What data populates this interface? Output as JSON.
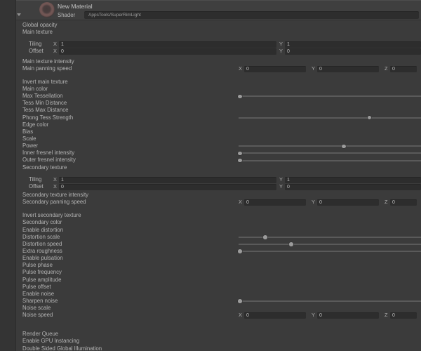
{
  "header": {
    "title": "New Material",
    "shader_label": "Shader",
    "shader_value": "AppsTools/SuperRimLight"
  },
  "colors": {
    "background": "#3b3b3b",
    "left_strip": "#343434",
    "field_background": "#2d2d2d",
    "text": "#b4b4b4",
    "slider_handle": "#9b9b9b",
    "material_icon_ring": "#735755"
  },
  "rows": [
    {
      "label": "Global opacity",
      "type": "label"
    },
    {
      "label": "Main texture",
      "type": "label"
    },
    {
      "label": "Tiling",
      "type": "vec2",
      "indent": true,
      "gap": 7,
      "fields": [
        {
          "axis": "X",
          "value": "1"
        },
        {
          "axis": "Y",
          "value": "1"
        }
      ]
    },
    {
      "label": "Offset",
      "type": "vec2",
      "indent": true,
      "fields": [
        {
          "axis": "X",
          "value": "0"
        },
        {
          "axis": "Y",
          "value": "0"
        }
      ]
    },
    {
      "label": "Main texture intensity",
      "type": "label",
      "gap": 4
    },
    {
      "label": "Main panning speed",
      "type": "vec3",
      "fields": [
        {
          "axis": "X",
          "value": "0"
        },
        {
          "axis": "Y",
          "value": "0"
        },
        {
          "axis": "Z",
          "value": "0"
        }
      ]
    },
    {
      "label": "Invert main texture",
      "type": "label",
      "gap": 9
    },
    {
      "label": "Main color",
      "type": "label"
    },
    {
      "label": "Max Tessellation",
      "type": "slider",
      "slider_fraction": 0
    },
    {
      "label": "Tess Min Distance",
      "type": "label"
    },
    {
      "label": "Tess Max Distance",
      "type": "label"
    },
    {
      "label": "Phong Tess Strength",
      "type": "slider",
      "slider_fraction": 0.73
    },
    {
      "label": "Edge color",
      "type": "label"
    },
    {
      "label": "Bias",
      "type": "label"
    },
    {
      "label": "Scale",
      "type": "label"
    },
    {
      "label": "Power",
      "type": "slider",
      "slider_fraction": 0.585
    },
    {
      "label": "Inner fresnel intensity",
      "type": "slider",
      "slider_fraction": 0
    },
    {
      "label": "Outer fresnel intensity",
      "type": "slider",
      "slider_fraction": 0
    },
    {
      "label": "Secondary texture",
      "type": "label"
    },
    {
      "label": "Tiling",
      "type": "vec2",
      "indent": true,
      "gap": 7,
      "fields": [
        {
          "axis": "X",
          "value": "1"
        },
        {
          "axis": "Y",
          "value": "1"
        }
      ]
    },
    {
      "label": "Offset",
      "type": "vec2",
      "indent": true,
      "fields": [
        {
          "axis": "X",
          "value": "0"
        },
        {
          "axis": "Y",
          "value": "0"
        }
      ]
    },
    {
      "label": "Secondary texture intensity",
      "type": "label",
      "gap": 2
    },
    {
      "label": "Secondary panning speed",
      "type": "vec3",
      "fields": [
        {
          "axis": "X",
          "value": "0"
        },
        {
          "axis": "Y",
          "value": "0"
        },
        {
          "axis": "Z",
          "value": "0"
        }
      ]
    },
    {
      "label": "Invert secondary texture",
      "type": "label",
      "gap": 9
    },
    {
      "label": "Secondary color",
      "type": "label"
    },
    {
      "label": "Enable distortion",
      "type": "label"
    },
    {
      "label": "Distortion scale",
      "type": "slider",
      "slider_fraction": 0.142
    },
    {
      "label": "Distortion speed",
      "type": "slider",
      "slider_fraction": 0.289
    },
    {
      "label": "Extra roughness",
      "type": "slider",
      "slider_fraction": 0
    },
    {
      "label": "Enable pulsation",
      "type": "label"
    },
    {
      "label": "Pulse phase",
      "type": "label"
    },
    {
      "label": "Pulse frequency",
      "type": "label"
    },
    {
      "label": "Pulse amplitude",
      "type": "label"
    },
    {
      "label": "Pulse offset",
      "type": "label"
    },
    {
      "label": "Enable noise",
      "type": "label"
    },
    {
      "label": "Sharpen noise",
      "type": "slider",
      "slider_fraction": 0
    },
    {
      "label": "Noise scale",
      "type": "label"
    },
    {
      "label": "Noise speed",
      "type": "vec3",
      "fields": [
        {
          "axis": "X",
          "value": "0"
        },
        {
          "axis": "Y",
          "value": "0"
        },
        {
          "axis": "Z",
          "value": "0"
        }
      ]
    },
    {
      "label": "Render Queue",
      "type": "label",
      "gap": 17
    },
    {
      "label": "Enable GPU Instancing",
      "type": "label"
    },
    {
      "label": "Double Sided Global Illumination",
      "type": "label"
    }
  ]
}
